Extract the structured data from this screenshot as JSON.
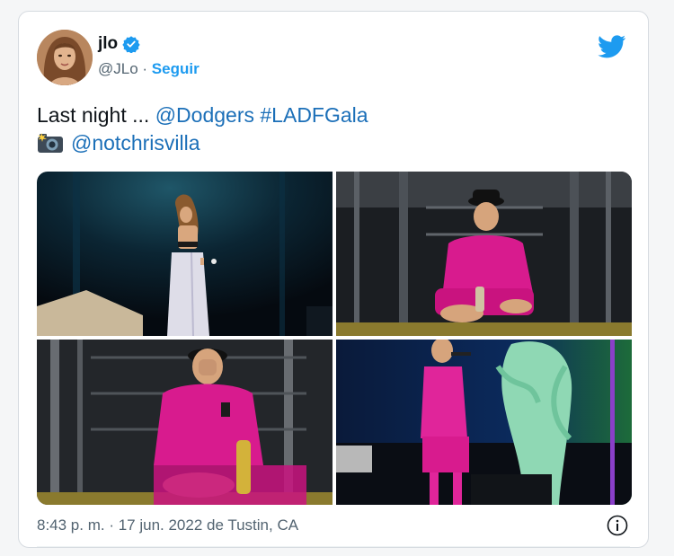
{
  "tweet": {
    "author": {
      "display_name": "jlo",
      "handle": "@JLo",
      "separator": " · ",
      "follow_label": "Seguir",
      "verified": true
    },
    "text": {
      "line1_prefix": "Last night ... ",
      "mention_1": "@Dodgers",
      "hashtag": "#LADFGala",
      "mention_2": "@notchrisvilla"
    },
    "meta": {
      "timestamp": "8:43 p. m. · 17 jun. 2022",
      "location_text": " de Tustin, CA"
    }
  },
  "colors": {
    "link": "#1b6fb8",
    "twitter_blue": "#1d9bf0",
    "secondary_text": "#536471"
  },
  "icons": {
    "brand": "twitter-bird-icon",
    "verified": "verified-badge-icon",
    "camera": "camera-flash-icon",
    "info": "info-icon"
  }
}
